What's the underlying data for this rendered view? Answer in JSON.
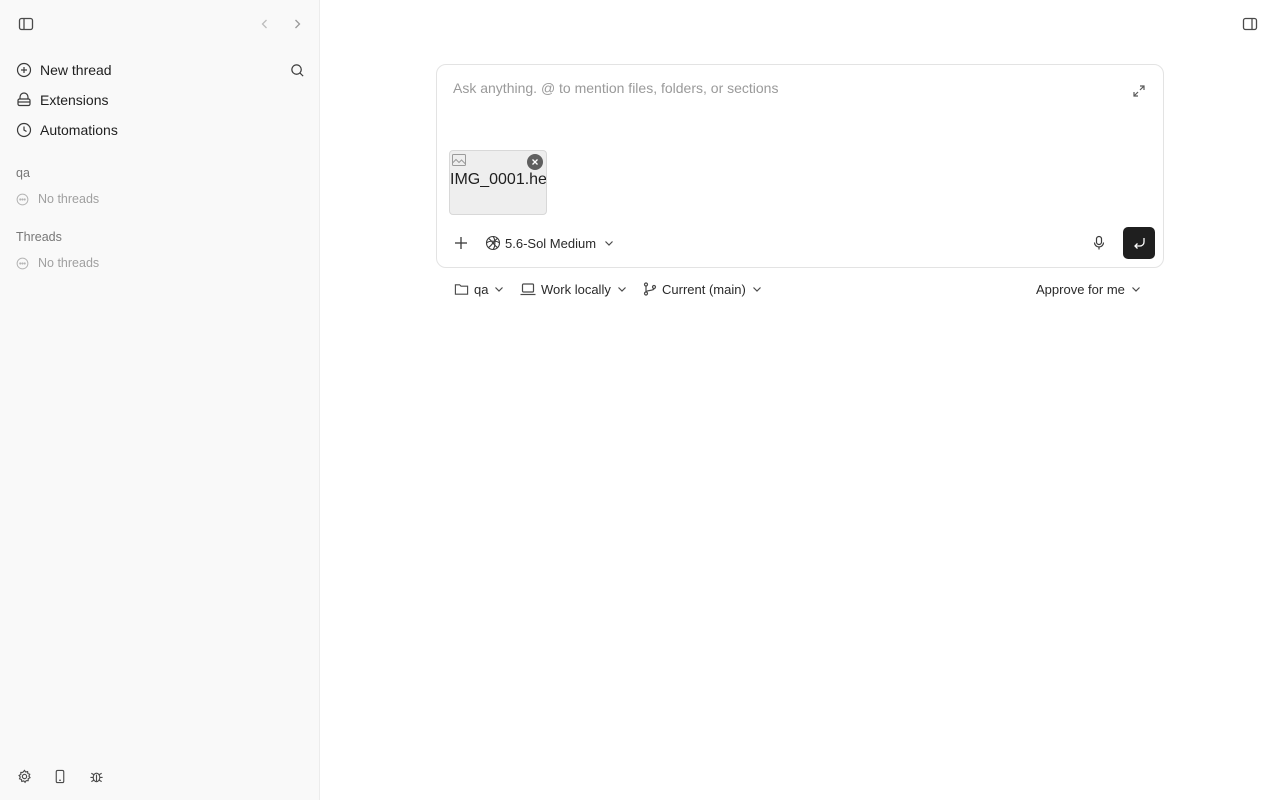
{
  "sidebar": {
    "nav": [
      {
        "label": "New thread"
      },
      {
        "label": "Extensions"
      },
      {
        "label": "Automations"
      }
    ],
    "sections": [
      {
        "label": "qa",
        "empty_label": "No threads"
      },
      {
        "label": "Threads",
        "empty_label": "No threads"
      }
    ],
    "footer_icons": [
      "gear-icon",
      "phone-icon",
      "bug-icon"
    ]
  },
  "composer": {
    "placeholder": "Ask anything. @ to mention files, folders, or sections",
    "attachment": {
      "name": "IMG_0001.he"
    },
    "model": "5.6-Sol Medium"
  },
  "toolbar": {
    "project": "qa",
    "environment": "Work locally",
    "branch": "Current (main)",
    "approval": "Approve for me"
  },
  "colors": {
    "accent": "#1f1f1f",
    "sidebar_bg": "#f9f9f9"
  }
}
